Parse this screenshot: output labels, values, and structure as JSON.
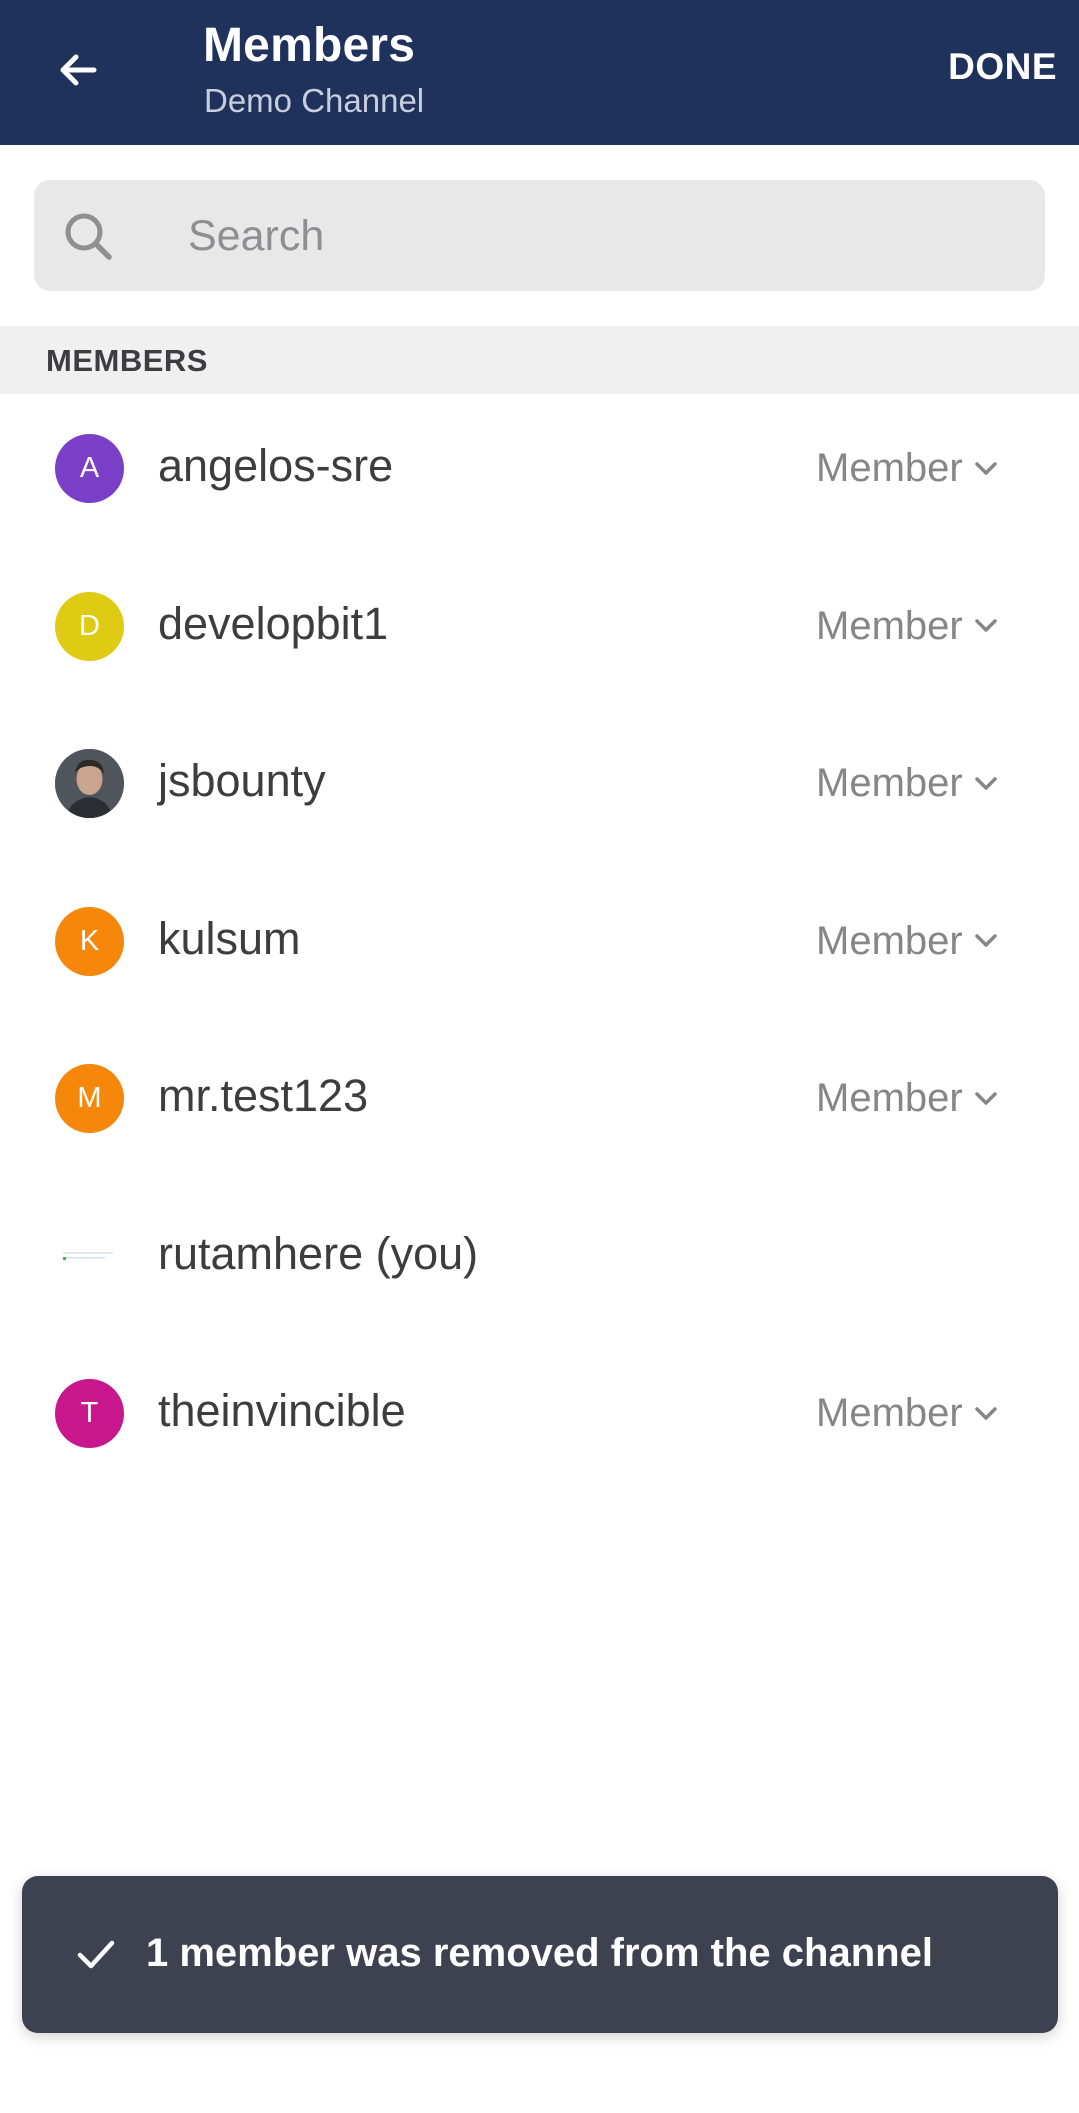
{
  "header": {
    "title": "Members",
    "subtitle": "Demo Channel",
    "done_label": "DONE",
    "background": "#1e325c"
  },
  "search": {
    "placeholder": "Search",
    "value": ""
  },
  "section": {
    "title": "MEMBERS"
  },
  "members": [
    {
      "initial": "A",
      "name": "angelos-sre",
      "role": "Member",
      "avatar_color": "#7b3ec7"
    },
    {
      "initial": "D",
      "name": "developbit1",
      "role": "Member",
      "avatar_color": "#e0cb14"
    },
    {
      "initial": "",
      "name": "jsbounty",
      "role": "Member",
      "avatar_color": "#4a4f55"
    },
    {
      "initial": "K",
      "name": "kulsum",
      "role": "Member",
      "avatar_color": "#f5870b"
    },
    {
      "initial": "M",
      "name": "mr.test123",
      "role": "Member",
      "avatar_color": "#f5870b"
    },
    {
      "initial": "",
      "name": "rutamhere (you)",
      "role": "",
      "avatar_color": "#ffffff"
    },
    {
      "initial": "T",
      "name": "theinvincible",
      "role": "Member",
      "avatar_color": "#c8168c"
    }
  ],
  "toast": {
    "message": "1 member was removed from the channel"
  }
}
